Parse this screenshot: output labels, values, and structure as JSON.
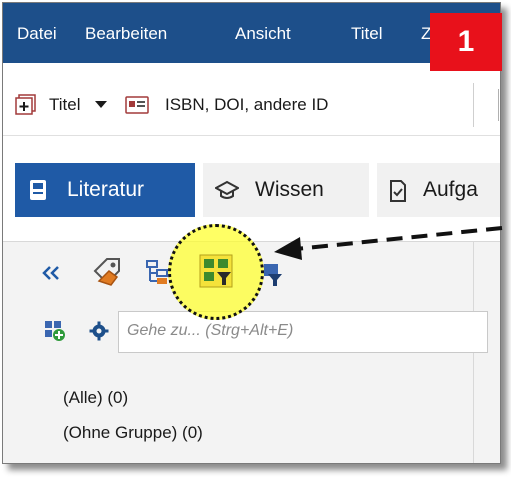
{
  "menu": {
    "items": [
      "Datei",
      "Bearbeiten",
      "Ansicht",
      "Titel",
      "Z"
    ]
  },
  "callout": {
    "number": "1",
    "color": "#e8111b"
  },
  "toolbar": {
    "title_label": "Titel",
    "id_label": "ISBN, DOI, andere ID"
  },
  "tabs": {
    "literatur": "Literatur",
    "wissen": "Wissen",
    "aufgaben": "Aufga"
  },
  "search": {
    "placeholder": "Gehe zu... (Strg+Alt+E)"
  },
  "groups": {
    "items": [
      "(Alle) (0)",
      "(Ohne Gruppe) (0)"
    ]
  },
  "icons": {
    "add_title": "add-title-icon",
    "dropdown": "chevron-down-icon",
    "id_card": "id-card-icon",
    "book": "book-icon",
    "graduation": "graduation-cap-icon",
    "task": "task-icon",
    "collapse": "double-chevron-left-icon",
    "tag": "tag-icon",
    "category": "category-tree-icon",
    "filter_group": "filter-group-icon",
    "filter": "filter-icon",
    "add_group": "add-group-icon",
    "settings": "gear-icon"
  },
  "colors": {
    "menubar": "#1d4f8a",
    "active_tab": "#1f5aa6",
    "highlight": "#ffff28"
  }
}
